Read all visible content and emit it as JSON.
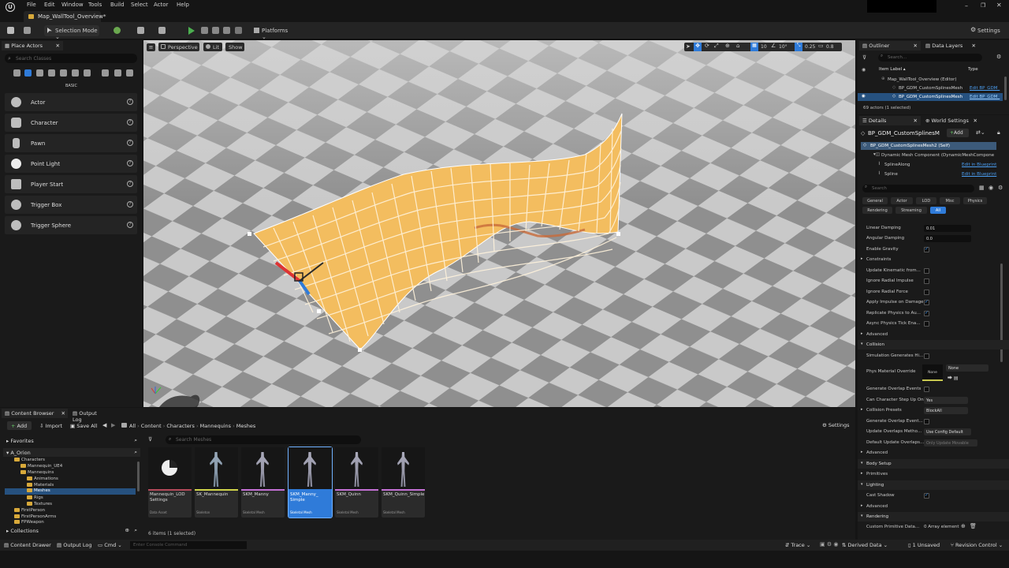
{
  "menubar": {
    "items": [
      "File",
      "Edit",
      "Window",
      "Tools",
      "Build",
      "Select",
      "Actor",
      "Help"
    ],
    "tab": "Map_WallTool_Overview*"
  },
  "toolbar": {
    "mode": "Selection Mode",
    "platforms": "Platforms",
    "settings": "Settings"
  },
  "place_actors": {
    "tab": "Place Actors",
    "search_placeholder": "Search Classes",
    "category": "BASIC",
    "items": [
      "Actor",
      "Character",
      "Pawn",
      "Point Light",
      "Player Start",
      "Trigger Box",
      "Trigger Sphere"
    ]
  },
  "viewport": {
    "perspective": "Perspective",
    "lit": "Lit",
    "show": "Show",
    "grid_snap": "10",
    "rot_snap": "10°",
    "scale_snap": "0.25",
    "cam_speed": "0.8"
  },
  "content_browser": {
    "tab": "Content Browser",
    "tab2": "Output Log",
    "add": "Add",
    "import": "Import",
    "save_all": "Save All",
    "breadcrumb": [
      "All",
      "Content",
      "Characters",
      "Mannequins",
      "Meshes"
    ],
    "settings": "Settings",
    "favorites": "Favorites",
    "root": "A_Orion",
    "search_placeholder": "Search Meshes",
    "tree": [
      "Characters",
      "Mannequin_UE4",
      "Mannequins",
      "Animations",
      "Materials",
      "Meshes",
      "Rigs",
      "Textures",
      "FirstPerson",
      "FirstPersonArms",
      "FPWeapon"
    ],
    "collections": "Collections",
    "count": "6 items (1 selected)",
    "assets": [
      {
        "name": "Mannequin_LOD Settings",
        "type": "Data Asset"
      },
      {
        "name": "SK_Mannequin",
        "type": "Skeleton"
      },
      {
        "name": "SKM_Manny",
        "type": "Skeletal Mesh"
      },
      {
        "name": "SKM_Manny_ Simple",
        "type": "Skeletal Mesh"
      },
      {
        "name": "SKM_Quinn",
        "type": "Skeletal Mesh"
      },
      {
        "name": "SKM_Quinn_Simple",
        "type": "Skeletal Mesh"
      }
    ]
  },
  "statusbar": {
    "content_drawer": "Content Drawer",
    "output_log": "Output Log",
    "cmd": "Cmd",
    "console_placeholder": "Enter Console Command",
    "trace": "Trace",
    "derived_data": "Derived Data",
    "unsaved": "1 Unsaved",
    "revision_control": "Revision Control"
  },
  "outliner": {
    "tab": "Outliner",
    "tab2": "Data Layers",
    "search_placeholder": "Search...",
    "col_label": "Item Label ▴",
    "col_type": "Type",
    "rows": [
      {
        "label": "Map_WallTool_Overview (Editor)",
        "type": ""
      },
      {
        "label": "BP_GDM_CustomSplinesMesh",
        "type": "Edit BP_GDM_"
      },
      {
        "label": "BP_GDM_CustomSplinesMesh",
        "type": "Edit BP_GDM_"
      }
    ],
    "count": "69 actors (1 selected)"
  },
  "details": {
    "tab": "Details",
    "tab2": "World Settings",
    "title": "BP_GDM_CustomSplinesM",
    "add": "Add",
    "components": [
      {
        "label": "BP_GDM_CustomSplinesMesh2 (Self)",
        "link": ""
      },
      {
        "label": "Dynamic Mesh Component (DynamicMeshCompone",
        "link": ""
      },
      {
        "label": "SplineAlong",
        "link": "Edit in Blueprint"
      },
      {
        "label": "Spline",
        "link": "Edit in Blueprint"
      }
    ],
    "search_placeholder": "Search",
    "filters": [
      "General",
      "Actor",
      "LOD",
      "Misc",
      "Physics",
      "Rendering",
      "Streaming",
      "All"
    ],
    "props": {
      "linear_damping": "Linear Damping",
      "linear_damping_val": "0.01",
      "angular_damping": "Angular Damping",
      "angular_damping_val": "0.0",
      "enable_gravity": "Enable Gravity",
      "constraints": "Constraints",
      "update_kinematic": "Update Kinematic from...",
      "ignore_radial_impulse": "Ignore Radial Impulse",
      "ignore_radial_force": "Ignore Radial Force",
      "apply_impulse": "Apply Impulse on Damage",
      "replicate_physics": "Replicate Physics to Au...",
      "async_physics": "Async Physics Tick Ena...",
      "advanced": "Advanced",
      "collision": "Collision",
      "sim_generates_hit": "Simulation Generates Hi...",
      "phys_material": "Phys Material Override",
      "phys_none": "None",
      "phys_none2": "None",
      "gen_overlap": "Generate Overlap Events",
      "can_step": "Can Character Step Up On",
      "can_step_val": "Yes",
      "collision_presets": "Collision Presets",
      "collision_presets_val": "BlockAll",
      "gen_overlap_during": "Generate Overlap Event...",
      "update_overlaps": "Update Overlaps Metho...",
      "update_overlaps_val": "Use Config Default",
      "default_update_overlaps": "Default Update Overlaps...",
      "default_update_overlaps_val": "Only Update Movable",
      "advanced2": "Advanced",
      "body_setup": "Body Setup",
      "primitives": "Primitives",
      "lighting": "Lighting",
      "cast_shadow": "Cast Shadow",
      "advanced3": "Advanced",
      "rendering": "Rendering",
      "custom_prim": "Custom Primitive Data...",
      "custom_prim_val": "0 Array element"
    }
  },
  "colors": {
    "accent": "#2f7bd9",
    "selection": "#26517f",
    "wall": "#f1c067",
    "panel": "#1a1a1a"
  }
}
